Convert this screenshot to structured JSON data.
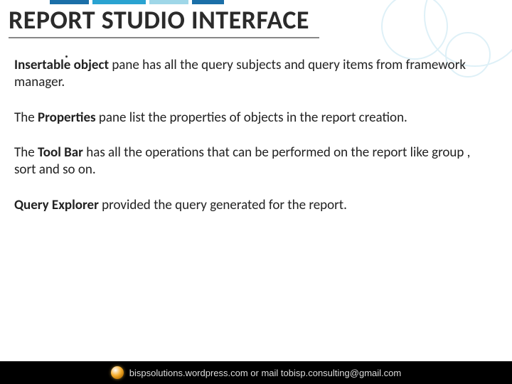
{
  "title": "REPORT STUDIO INTERFACE",
  "paragraphs": [
    {
      "bold": "Insertable object",
      "rest": " pane has all the query subjects and query items from framework manager."
    },
    {
      "bold": "",
      "rest": "The Properties pane list the properties  of objects in the report  creation.",
      "lead": "The ",
      "boldmid": "Properties",
      "tail": " pane list the properties  of objects in the report  creation."
    },
    {
      "lead": "The ",
      "boldmid": "Tool Bar",
      "tail": " has all the operations that can be performed on the report like group , sort and so on."
    },
    {
      "boldmid": "Query Explorer",
      "tail": " provided the query generated for the report.",
      "lead": ""
    }
  ],
  "footer": {
    "text_before": "bispsolutions.wordpress.com or mail to ",
    "email": "bisp.consulting@gmail.com"
  }
}
